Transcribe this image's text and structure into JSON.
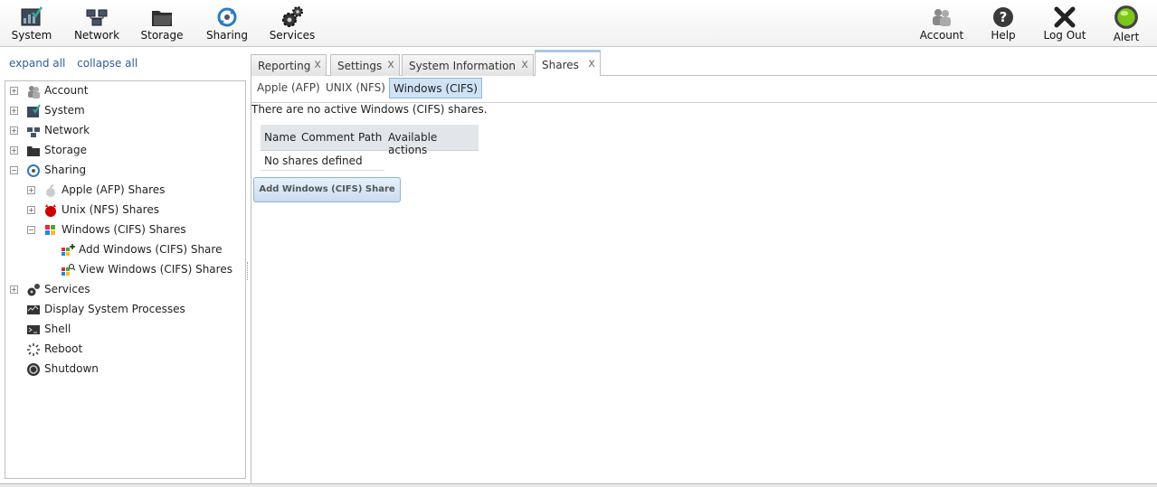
{
  "toolbar": {
    "system": "System",
    "network": "Network",
    "storage": "Storage",
    "sharing": "Sharing",
    "services": "Services",
    "account": "Account",
    "help": "Help",
    "logout": "Log Out",
    "alert": "Alert"
  },
  "left": {
    "expand_all": "expand all",
    "collapse_all": "collapse all"
  },
  "tree": {
    "account": "Account",
    "system": "System",
    "network": "Network",
    "storage": "Storage",
    "sharing": "Sharing",
    "afp": "Apple (AFP) Shares",
    "nfs": "Unix (NFS) Shares",
    "cifs": "Windows (CIFS) Shares",
    "add_cifs": "Add Windows (CIFS) Share",
    "view_cifs": "View Windows (CIFS) Shares",
    "services": "Services",
    "processes": "Display System Processes",
    "shell": "Shell",
    "reboot": "Reboot",
    "shutdown": "Shutdown"
  },
  "tabs": {
    "reporting": "Reporting",
    "settings": "Settings",
    "sysinfo": "System Information",
    "shares": "Shares",
    "close": "x"
  },
  "subtabs": {
    "afp": "Apple (AFP)",
    "nfs": "UNIX (NFS)",
    "cifs": "Windows (CIFS)"
  },
  "content": {
    "message": "There are no active Windows (CIFS) shares.",
    "columns": [
      "Name",
      "Comment",
      "Path",
      "Available actions"
    ],
    "empty": "No shares defined",
    "add_button": "Add Windows (CIFS) Share"
  },
  "colors": {
    "accent": "#2b5f9e",
    "active_subtab": "#cfe3f6",
    "alert_green": "#7cc51a"
  }
}
